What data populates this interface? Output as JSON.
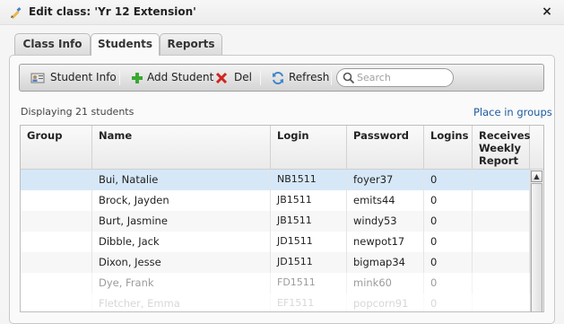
{
  "window": {
    "title": "Edit class: 'Yr 12 Extension'",
    "close_label": "×"
  },
  "tabs": [
    {
      "label": "Class Info",
      "active": false
    },
    {
      "label": "Students",
      "active": true
    },
    {
      "label": "Reports",
      "active": false
    }
  ],
  "toolbar": {
    "student_info": "Student Info",
    "add_student": "Add Student",
    "del": "Del",
    "refresh": "Refresh",
    "search_placeholder": "Search"
  },
  "status": {
    "displaying": "Displaying 21 students",
    "place_in_groups": "Place in groups"
  },
  "grid": {
    "columns": [
      "Group",
      "Name",
      "Login",
      "Password",
      "Logins",
      "Receives Weekly Report"
    ],
    "rows": [
      {
        "group": "",
        "name": "Bui, Natalie",
        "login": "NB1511",
        "password": "foyer37",
        "logins": "0",
        "report": ""
      },
      {
        "group": "",
        "name": "Brock, Jayden",
        "login": "JB1511",
        "password": "emits44",
        "logins": "0",
        "report": ""
      },
      {
        "group": "",
        "name": "Burt, Jasmine",
        "login": "JB1511",
        "password": "windy53",
        "logins": "0",
        "report": ""
      },
      {
        "group": "",
        "name": "Dibble, Jack",
        "login": "JD1511",
        "password": "newpot17",
        "logins": "0",
        "report": ""
      },
      {
        "group": "",
        "name": "Dixon, Jesse",
        "login": "JD1511",
        "password": "bigmap34",
        "logins": "0",
        "report": ""
      },
      {
        "group": "",
        "name": "Dye, Frank",
        "login": "FD1511",
        "password": "mink60",
        "logins": "0",
        "report": ""
      },
      {
        "group": "",
        "name": "Fletcher, Emma",
        "login": "EF1511",
        "password": "popcorn91",
        "logins": "0",
        "report": ""
      }
    ]
  },
  "colors": {
    "selected_row": "#d6e8f8",
    "link": "#1e5aa0"
  }
}
